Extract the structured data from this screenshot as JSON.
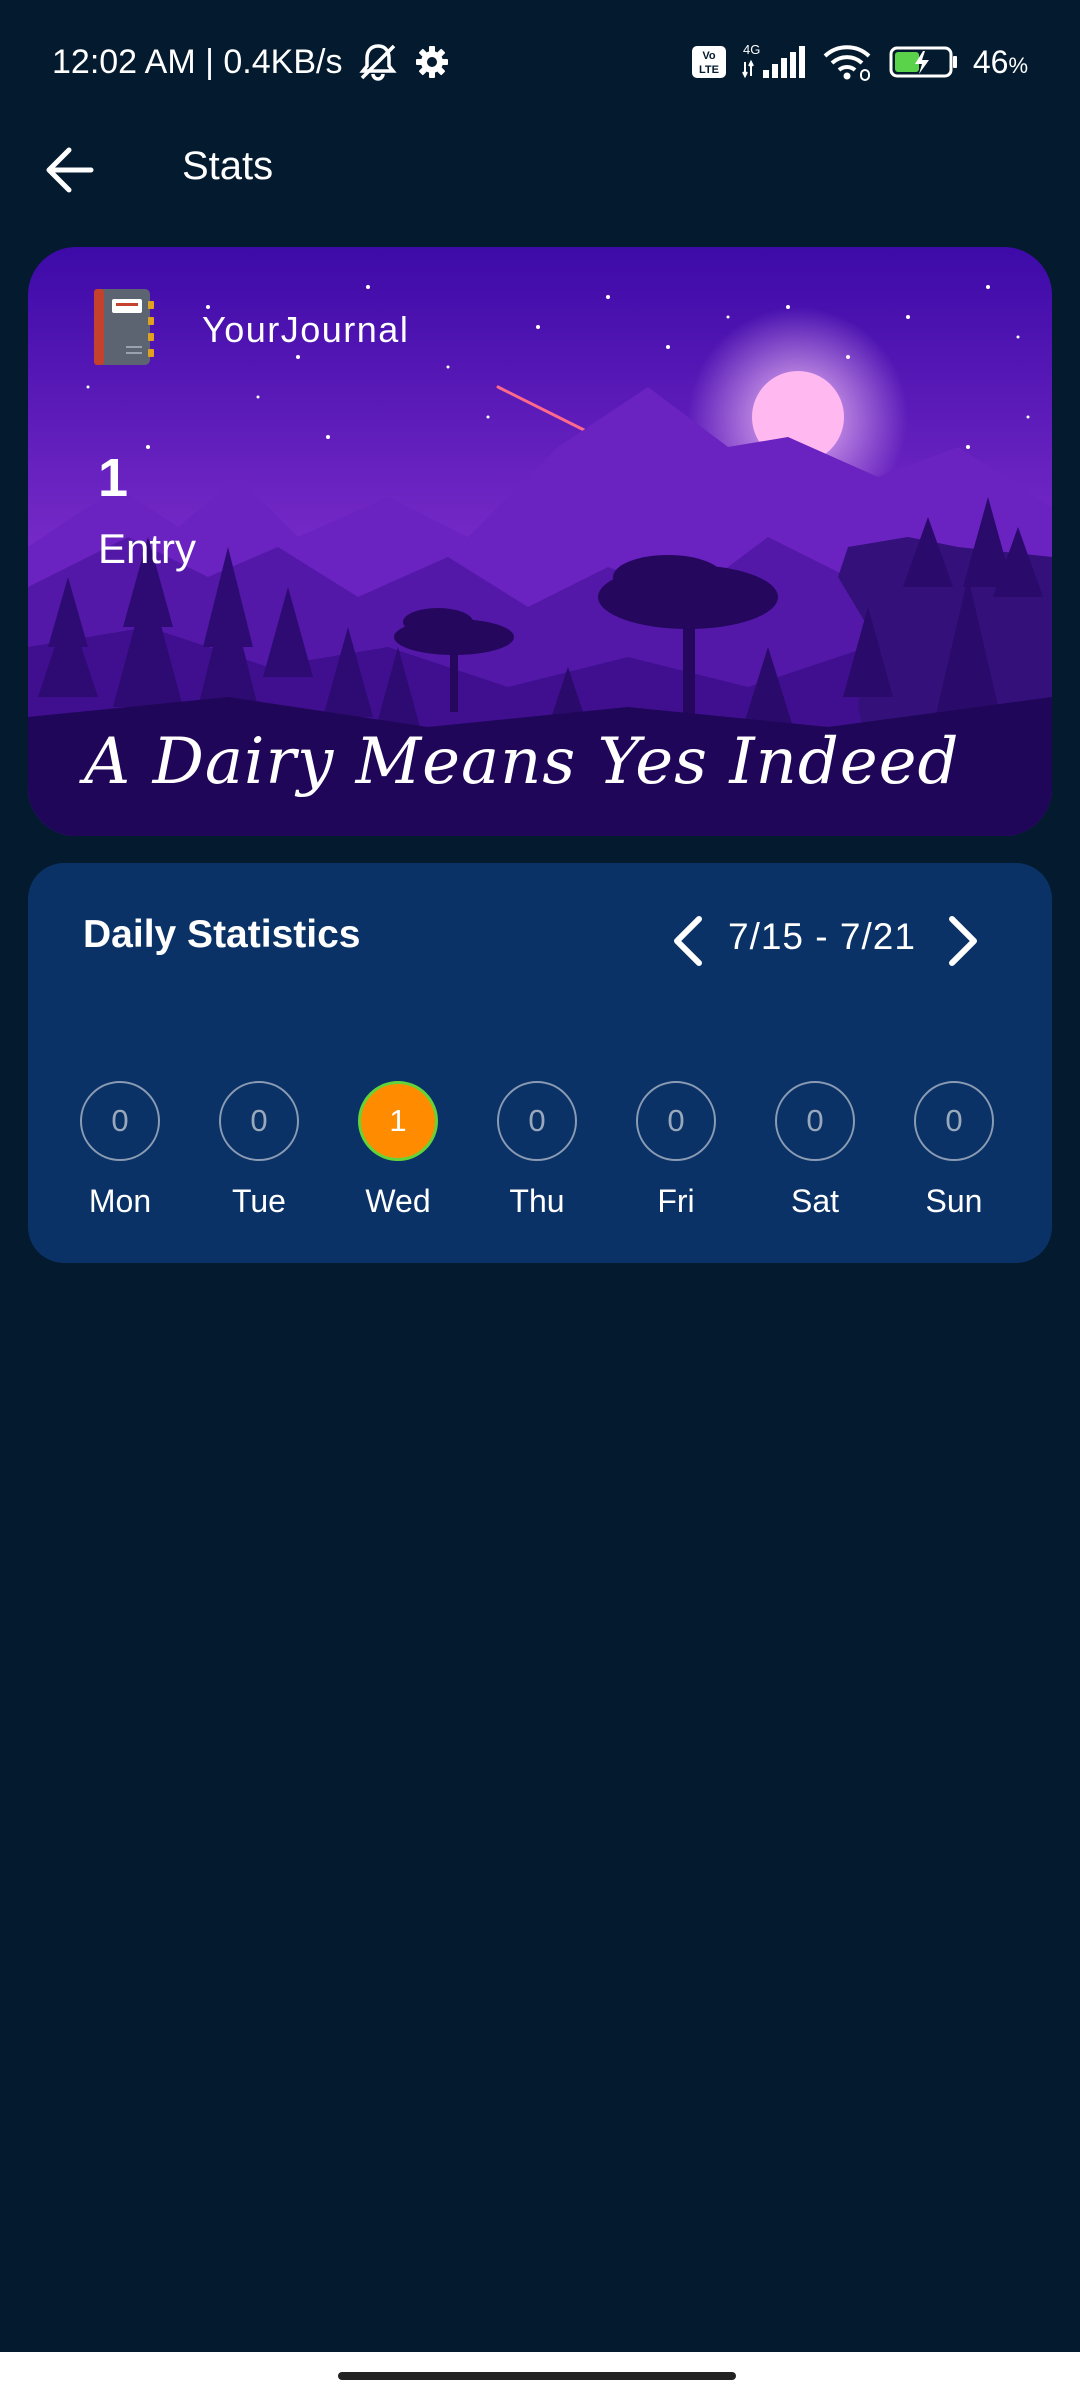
{
  "status_bar": {
    "time_speed": "12:02 AM | 0.4KB/s",
    "network_label": "4G",
    "volte_label": "Vo LTE",
    "battery_percent": "46",
    "battery_unit": "%"
  },
  "app_bar": {
    "title": "Stats"
  },
  "hero": {
    "brand": "YourJournal",
    "entry_count": "1",
    "entry_label": "Entry",
    "tagline": "A Dairy Means Yes Indeed"
  },
  "stats": {
    "title": "Daily Statistics",
    "week_range": "7/15 - 7/21",
    "days": [
      {
        "label": "Mon",
        "count": "0",
        "active": false
      },
      {
        "label": "Tue",
        "count": "0",
        "active": false
      },
      {
        "label": "Wed",
        "count": "1",
        "active": true
      },
      {
        "label": "Thu",
        "count": "0",
        "active": false
      },
      {
        "label": "Fri",
        "count": "0",
        "active": false
      },
      {
        "label": "Sat",
        "count": "0",
        "active": false
      },
      {
        "label": "Sun",
        "count": "0",
        "active": false
      }
    ]
  },
  "colors": {
    "background": "#041a2e",
    "card": "#0a3266",
    "active_day": "#ff8c00",
    "active_ring": "#62d43a"
  },
  "icons": [
    "back-arrow-icon",
    "mute-icon",
    "gear-icon",
    "volte-icon",
    "signal-icon",
    "wifi-icon",
    "battery-icon",
    "journal-icon",
    "chevron-left-icon",
    "chevron-right-icon"
  ]
}
